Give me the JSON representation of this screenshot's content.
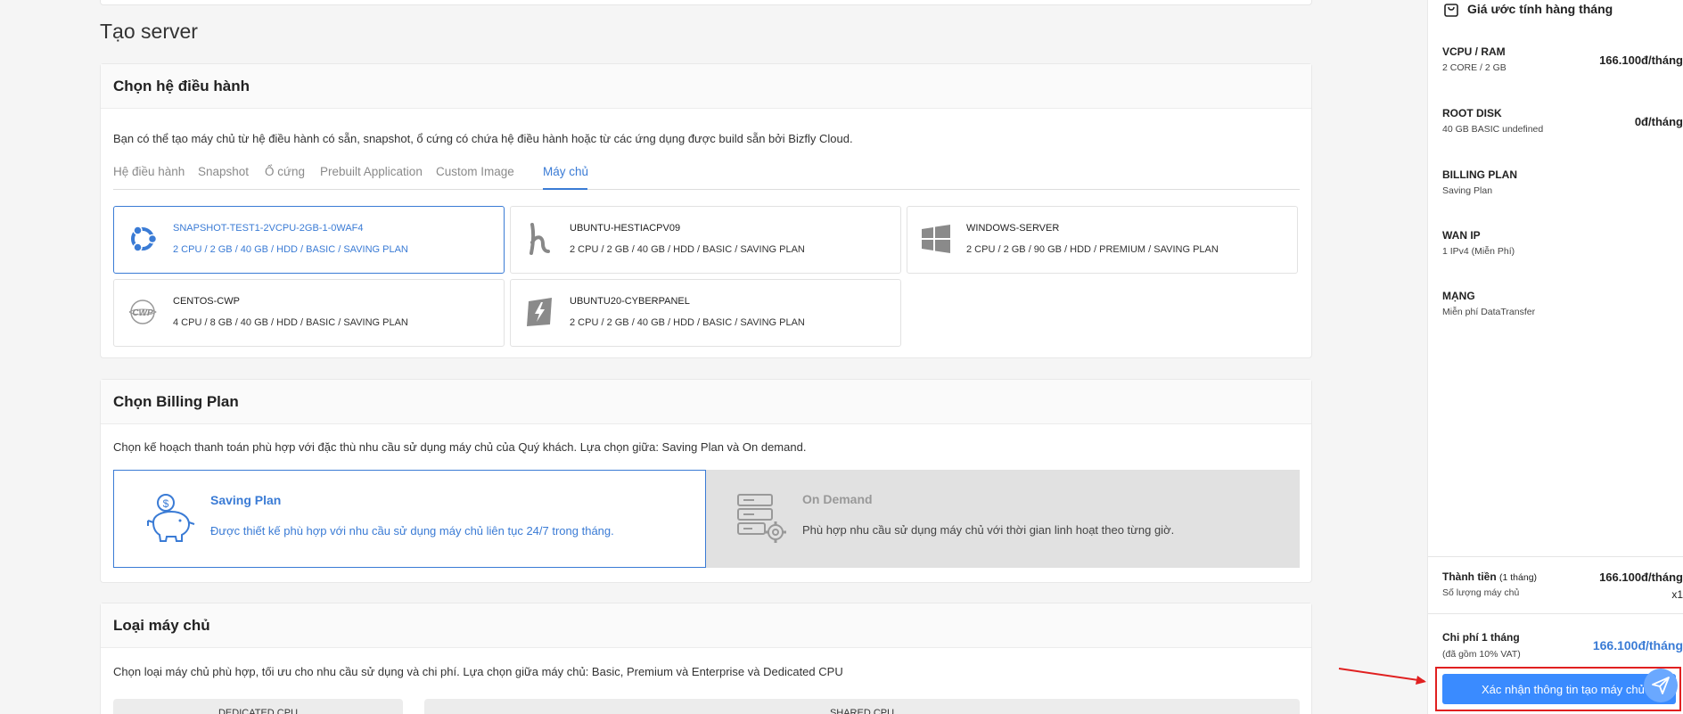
{
  "page": {
    "title": "Tạo server"
  },
  "os_section": {
    "heading": "Chọn hệ điều hành",
    "description": "Bạn có thể tạo máy chủ từ hệ điều hành có sẵn, snapshot, ổ cứng có chứa hệ điều hành hoặc từ các ứng dụng được build sẵn bởi Bizfly Cloud.",
    "tabs": [
      "Hệ điều hành",
      "Snapshot",
      "Ổ cứng",
      "Prebuilt Application",
      "Custom Image",
      "Máy chủ"
    ],
    "active_tab": "Máy chủ",
    "servers": [
      {
        "name": "SNAPSHOT-TEST1-2VCPU-2GB-1-0WAF4",
        "spec": "2 CPU / 2 GB / 40 GB / HDD / BASIC / SAVING PLAN",
        "icon": "ubuntu-icon",
        "selected": true
      },
      {
        "name": "UBUNTU-HESTIACPV09",
        "spec": "2 CPU / 2 GB / 40 GB / HDD / BASIC / SAVING PLAN",
        "icon": "hestia-icon",
        "selected": false
      },
      {
        "name": "WINDOWS-SERVER",
        "spec": "2 CPU / 2 GB / 90 GB / HDD / PREMIUM / SAVING PLAN",
        "icon": "windows-icon",
        "selected": false
      },
      {
        "name": "CENTOS-CWP",
        "spec": "4 CPU / 8 GB / 40 GB / HDD / BASIC / SAVING PLAN",
        "icon": "cwp-icon",
        "selected": false
      },
      {
        "name": "UBUNTU20-CYBERPANEL",
        "spec": "2 CPU / 2 GB / 40 GB / HDD / BASIC / SAVING PLAN",
        "icon": "cyberpanel-icon",
        "selected": false
      }
    ]
  },
  "billing_section": {
    "heading": "Chọn Billing Plan",
    "description": "Chọn kế hoạch thanh toán phù hợp với đặc thù nhu cầu sử dụng máy chủ của Quý khách. Lựa chọn giữa: Saving Plan và On demand.",
    "plans": [
      {
        "title": "Saving Plan",
        "desc": "Được thiết kế phù hợp với nhu cầu sử dụng máy chủ liên tục 24/7 trong tháng.",
        "icon": "piggy-bank-icon",
        "selected": true
      },
      {
        "title": "On Demand",
        "desc": "Phù hợp nhu cầu sử dụng máy chủ với thời gian linh hoạt theo từng giờ.",
        "icon": "server-gear-icon",
        "selected": false
      }
    ]
  },
  "type_section": {
    "heading": "Loại máy chủ",
    "description": "Chọn loại máy chủ phù hợp, tối ưu cho nhu cầu sử dụng và chi phí. Lựa chọn giữa máy chủ: Basic, Premium và Enterprise và Dedicated CPU",
    "tabs": [
      "DEDICATED CPU",
      "SHARED CPU"
    ]
  },
  "summary": {
    "header": "Giá ước tính hàng tháng",
    "items": [
      {
        "label": "VCPU / RAM",
        "sub": "2 CORE / 2 GB",
        "price": "166.100đ/tháng"
      },
      {
        "label": "ROOT DISK",
        "sub": "40 GB BASIC undefined",
        "price": "0đ/tháng"
      },
      {
        "label": "BILLING PLAN",
        "sub": "Saving Plan",
        "price": ""
      },
      {
        "label": "WAN IP",
        "sub": "1 IPv4 (Miễn Phí)",
        "price": ""
      },
      {
        "label": "MẠNG",
        "sub": "Miễn phí DataTransfer",
        "price": ""
      }
    ],
    "subtotal": {
      "label": "Thành tiền",
      "label_note": "(1 tháng)",
      "price": "166.100đ/tháng",
      "qty_label": "Số lượng máy chủ",
      "qty": "x1"
    },
    "total": {
      "label": "Chi phí 1 tháng",
      "note": "(đã gồm 10% VAT)",
      "price": "166.100đ/tháng"
    },
    "confirm_label": "Xác nhận thông tin tạo máy chủ"
  },
  "colors": {
    "accent": "#3a7bd5",
    "button": "#3a8bff",
    "highlight": "#e02020"
  }
}
